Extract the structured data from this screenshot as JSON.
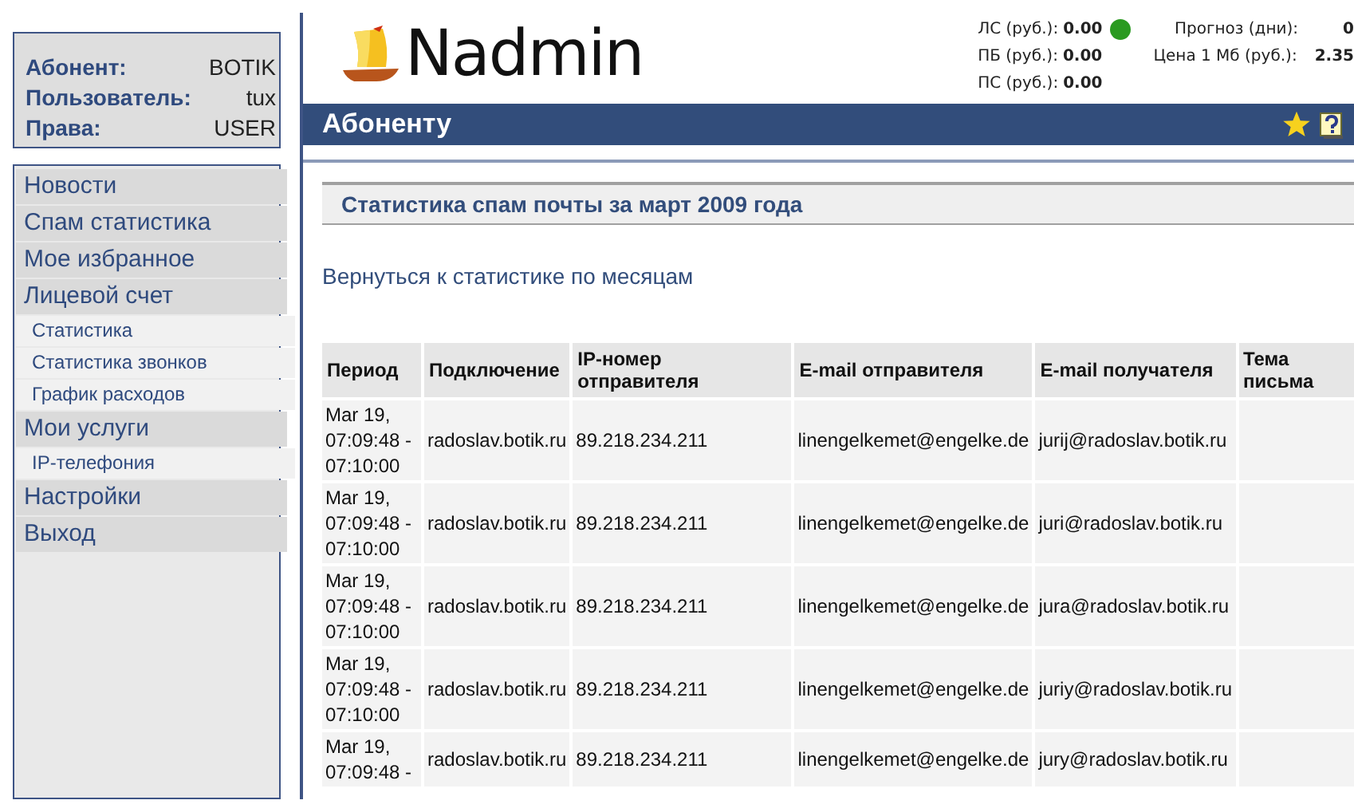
{
  "user_info": [
    {
      "label": "Абонент:",
      "value": "BOTIK"
    },
    {
      "label": "Пользователь:",
      "value": "tux"
    },
    {
      "label": "Права:",
      "value": "USER"
    }
  ],
  "menu": [
    {
      "label": "Новости",
      "kind": "main"
    },
    {
      "label": "Спам статистика",
      "kind": "main"
    },
    {
      "label": "Мое избранное",
      "kind": "main"
    },
    {
      "label": "Лицевой счет",
      "kind": "main"
    },
    {
      "label": "Статистика",
      "kind": "sub"
    },
    {
      "label": "Статистика звонков",
      "kind": "sub"
    },
    {
      "label": "График расходов",
      "kind": "sub"
    },
    {
      "label": "Мои услуги",
      "kind": "main"
    },
    {
      "label": "IP-телефония",
      "kind": "sub"
    },
    {
      "label": "Настройки",
      "kind": "main"
    },
    {
      "label": "Выход",
      "kind": "main"
    }
  ],
  "logo": {
    "text": "Nadmin"
  },
  "balance": [
    {
      "label": "ЛС (руб.):",
      "value": "0.00",
      "color": "#2a9a20"
    },
    {
      "label": "ПБ (руб.):",
      "value": "0.00"
    },
    {
      "label": "ПС (руб.):",
      "value": "0.00"
    }
  ],
  "forecast": [
    {
      "label": "Прогноз (дни):",
      "value": "0"
    },
    {
      "label": "Цена 1 Мб (руб.):",
      "value": "2.35"
    }
  ],
  "section_bar": {
    "title": "Абоненту"
  },
  "page_title": "Статистика спам почты за март 2009 года",
  "back_link": "Вернуться к статистике по месяцам",
  "table": {
    "columns": [
      "Период",
      "Подключение",
      "IP-номер отправителя",
      "E-mail отправителя",
      "E-mail получателя",
      "Тема письма"
    ],
    "rows": [
      {
        "period": [
          "Mar 19,",
          "07:09:48 -",
          "07:10:00"
        ],
        "connection": "radoslav.botik.ru",
        "ip": "89.218.234.211",
        "from": "linengelkemet@engelke.de",
        "to": "jurij@radoslav.botik.ru"
      },
      {
        "period": [
          "Mar 19,",
          "07:09:48 -",
          "07:10:00"
        ],
        "connection": "radoslav.botik.ru",
        "ip": "89.218.234.211",
        "from": "linengelkemet@engelke.de",
        "to": "juri@radoslav.botik.ru"
      },
      {
        "period": [
          "Mar 19,",
          "07:09:48 -",
          "07:10:00"
        ],
        "connection": "radoslav.botik.ru",
        "ip": "89.218.234.211",
        "from": "linengelkemet@engelke.de",
        "to": "jura@radoslav.botik.ru"
      },
      {
        "period": [
          "Mar 19,",
          "07:09:48 -",
          "07:10:00"
        ],
        "connection": "radoslav.botik.ru",
        "ip": "89.218.234.211",
        "from": "linengelkemet@engelke.de",
        "to": "juriy@radoslav.botik.ru"
      },
      {
        "period": [
          "Mar 19,",
          "07:09:48 -"
        ],
        "connection": "radoslav.botik.ru",
        "ip": "89.218.234.211",
        "from": "linengelkemet@engelke.de",
        "to": "jury@radoslav.botik.ru"
      }
    ]
  }
}
